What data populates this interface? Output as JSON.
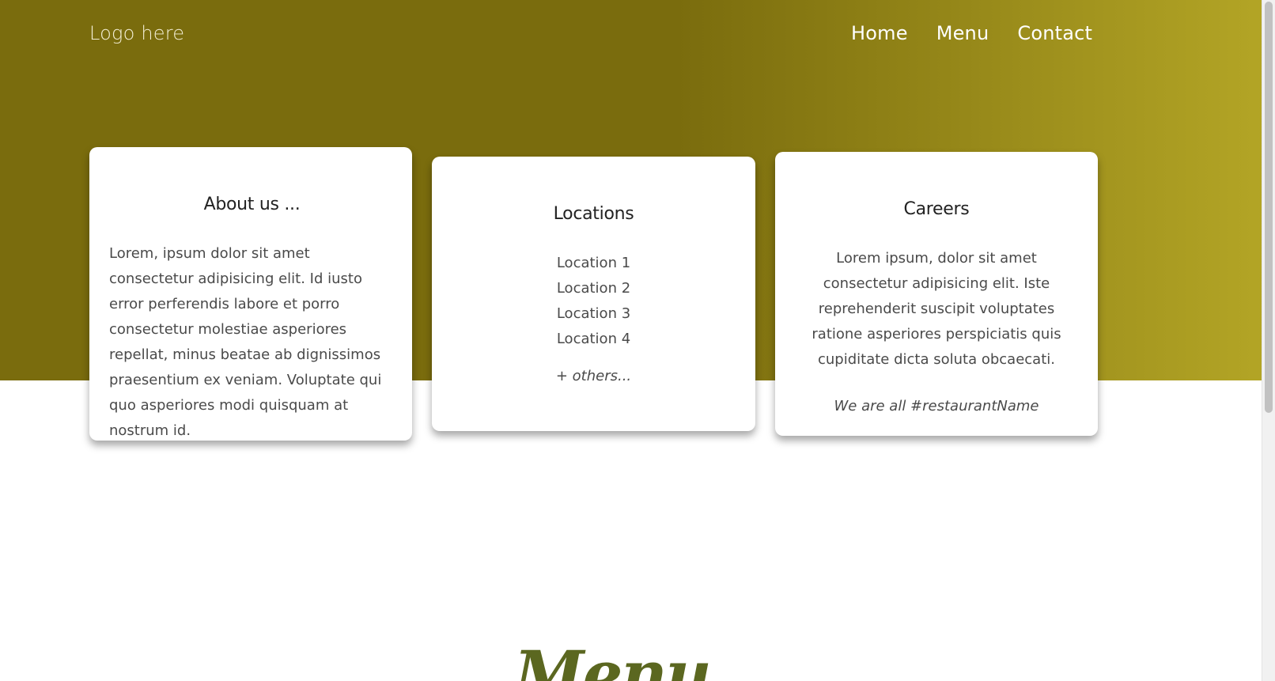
{
  "header": {
    "logo": "Logo here",
    "nav": [
      "Home",
      "Menu",
      "Contact"
    ]
  },
  "cards": {
    "about": {
      "title": "About us ...",
      "body": "Lorem, ipsum dolor sit amet consectetur adipisicing elit. Id iusto error perferendis labore et porro consectetur molestiae asperiores repellat, minus beatae ab dignissimos praesentium ex veniam. Voluptate qui quo asperiores modi quisquam at nostrum id."
    },
    "locations": {
      "title": "Locations",
      "items": [
        "Location 1",
        "Location 2",
        "Location 3",
        "Location 4"
      ],
      "more": "+ others..."
    },
    "careers": {
      "title": "Careers",
      "body": "Lorem ipsum, dolor sit amet consectetur adipisicing elit. Iste reprehenderit suscipit voluptates ratione asperiores perspiciatis quis cupiditate dicta soluta obcaecati.",
      "tagline": "We are all #restaurantName"
    }
  },
  "menu_section": {
    "heading": "Menu"
  },
  "colors": {
    "hero_dark": "#7a6c0d",
    "hero_light": "#b4a626",
    "menu_heading": "#5b6720"
  }
}
